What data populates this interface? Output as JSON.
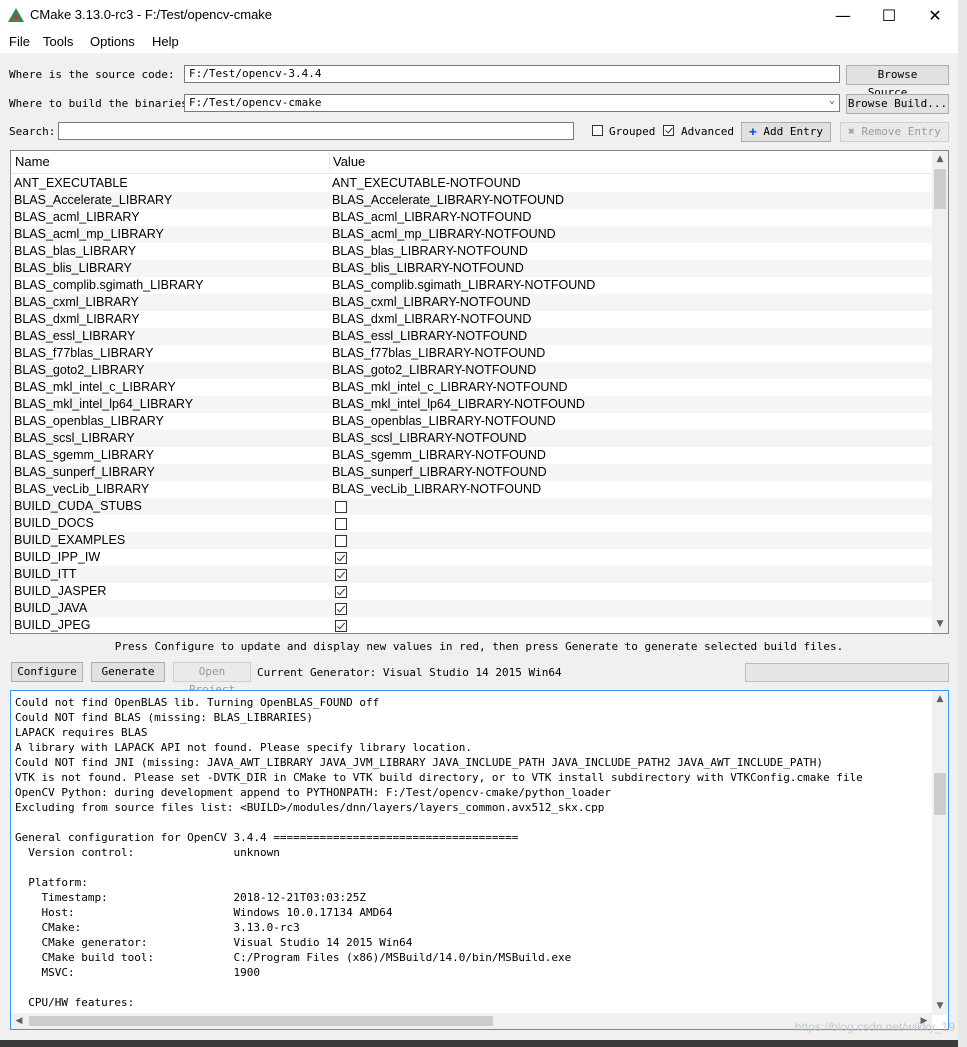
{
  "window": {
    "title": "CMake 3.13.0-rc3 - F:/Test/opencv-cmake",
    "minimize": "—",
    "maximize": "☐",
    "close": "✕"
  },
  "menu": [
    "File",
    "Tools",
    "Options",
    "Help"
  ],
  "source": {
    "label": "Where is the source code:",
    "value": "F:/Test/opencv-3.4.4",
    "browse": "Browse Source..."
  },
  "build": {
    "label": "Where to build the binaries:",
    "value": "F:/Test/opencv-cmake",
    "browse": "Browse Build..."
  },
  "search": {
    "label": "Search:",
    "value": ""
  },
  "grouped": {
    "label": "Grouped",
    "checked": false
  },
  "advanced": {
    "label": "Advanced",
    "checked": true
  },
  "add_entry": "Add Entry",
  "remove_entry": "Remove Entry",
  "table": {
    "col_name": "Name",
    "col_value": "Value",
    "rows": [
      {
        "name": "ANT_EXECUTABLE",
        "value": "ANT_EXECUTABLE-NOTFOUND"
      },
      {
        "name": "BLAS_Accelerate_LIBRARY",
        "value": "BLAS_Accelerate_LIBRARY-NOTFOUND"
      },
      {
        "name": "BLAS_acml_LIBRARY",
        "value": "BLAS_acml_LIBRARY-NOTFOUND"
      },
      {
        "name": "BLAS_acml_mp_LIBRARY",
        "value": "BLAS_acml_mp_LIBRARY-NOTFOUND"
      },
      {
        "name": "BLAS_blas_LIBRARY",
        "value": "BLAS_blas_LIBRARY-NOTFOUND"
      },
      {
        "name": "BLAS_blis_LIBRARY",
        "value": "BLAS_blis_LIBRARY-NOTFOUND"
      },
      {
        "name": "BLAS_complib.sgimath_LIBRARY",
        "value": "BLAS_complib.sgimath_LIBRARY-NOTFOUND"
      },
      {
        "name": "BLAS_cxml_LIBRARY",
        "value": "BLAS_cxml_LIBRARY-NOTFOUND"
      },
      {
        "name": "BLAS_dxml_LIBRARY",
        "value": "BLAS_dxml_LIBRARY-NOTFOUND"
      },
      {
        "name": "BLAS_essl_LIBRARY",
        "value": "BLAS_essl_LIBRARY-NOTFOUND"
      },
      {
        "name": "BLAS_f77blas_LIBRARY",
        "value": "BLAS_f77blas_LIBRARY-NOTFOUND"
      },
      {
        "name": "BLAS_goto2_LIBRARY",
        "value": "BLAS_goto2_LIBRARY-NOTFOUND"
      },
      {
        "name": "BLAS_mkl_intel_c_LIBRARY",
        "value": "BLAS_mkl_intel_c_LIBRARY-NOTFOUND"
      },
      {
        "name": "BLAS_mkl_intel_lp64_LIBRARY",
        "value": "BLAS_mkl_intel_lp64_LIBRARY-NOTFOUND"
      },
      {
        "name": "BLAS_openblas_LIBRARY",
        "value": "BLAS_openblas_LIBRARY-NOTFOUND"
      },
      {
        "name": "BLAS_scsl_LIBRARY",
        "value": "BLAS_scsl_LIBRARY-NOTFOUND"
      },
      {
        "name": "BLAS_sgemm_LIBRARY",
        "value": "BLAS_sgemm_LIBRARY-NOTFOUND"
      },
      {
        "name": "BLAS_sunperf_LIBRARY",
        "value": "BLAS_sunperf_LIBRARY-NOTFOUND"
      },
      {
        "name": "BLAS_vecLib_LIBRARY",
        "value": "BLAS_vecLib_LIBRARY-NOTFOUND"
      },
      {
        "name": "BUILD_CUDA_STUBS",
        "checkbox": true,
        "checked": false
      },
      {
        "name": "BUILD_DOCS",
        "checkbox": true,
        "checked": false
      },
      {
        "name": "BUILD_EXAMPLES",
        "checkbox": true,
        "checked": false
      },
      {
        "name": "BUILD_IPP_IW",
        "checkbox": true,
        "checked": true
      },
      {
        "name": "BUILD_ITT",
        "checkbox": true,
        "checked": true
      },
      {
        "name": "BUILD_JASPER",
        "checkbox": true,
        "checked": true
      },
      {
        "name": "BUILD_JAVA",
        "checkbox": true,
        "checked": true
      },
      {
        "name": "BUILD_JPEG",
        "checkbox": true,
        "checked": true
      }
    ]
  },
  "hint": "Press Configure to update and display new values in red, then press Generate to generate selected build files.",
  "actions": {
    "configure": "Configure",
    "generate": "Generate",
    "open_project": "Open Project",
    "generator": "Current Generator: Visual Studio 14 2015 Win64"
  },
  "output": [
    "Could not find OpenBLAS lib. Turning OpenBLAS_FOUND off",
    "Could NOT find BLAS (missing: BLAS_LIBRARIES)",
    "LAPACK requires BLAS",
    "A library with LAPACK API not found. Please specify library location.",
    "Could NOT find JNI (missing: JAVA_AWT_LIBRARY JAVA_JVM_LIBRARY JAVA_INCLUDE_PATH JAVA_INCLUDE_PATH2 JAVA_AWT_INCLUDE_PATH)",
    "VTK is not found. Please set -DVTK_DIR in CMake to VTK build directory, or to VTK install subdirectory with VTKConfig.cmake file",
    "OpenCV Python: during development append to PYTHONPATH: F:/Test/opencv-cmake/python_loader",
    "Excluding from source files list: <BUILD>/modules/dnn/layers/layers_common.avx512_skx.cpp",
    "",
    "General configuration for OpenCV 3.4.4 =====================================",
    "  Version control:               unknown",
    "",
    "  Platform:",
    "    Timestamp:                   2018-12-21T03:03:25Z",
    "    Host:                        Windows 10.0.17134 AMD64",
    "    CMake:                       3.13.0-rc3",
    "    CMake generator:             Visual Studio 14 2015 Win64",
    "    CMake build tool:            C:/Program Files (x86)/MSBuild/14.0/bin/MSBuild.exe",
    "    MSVC:                        1900",
    "",
    "  CPU/HW features:"
  ],
  "watermark": "https://blog.csdn.net/wikky_19",
  "icons": {
    "add": "plus-icon",
    "remove": "x-icon"
  },
  "colors": {
    "accent": "#3399ff"
  }
}
